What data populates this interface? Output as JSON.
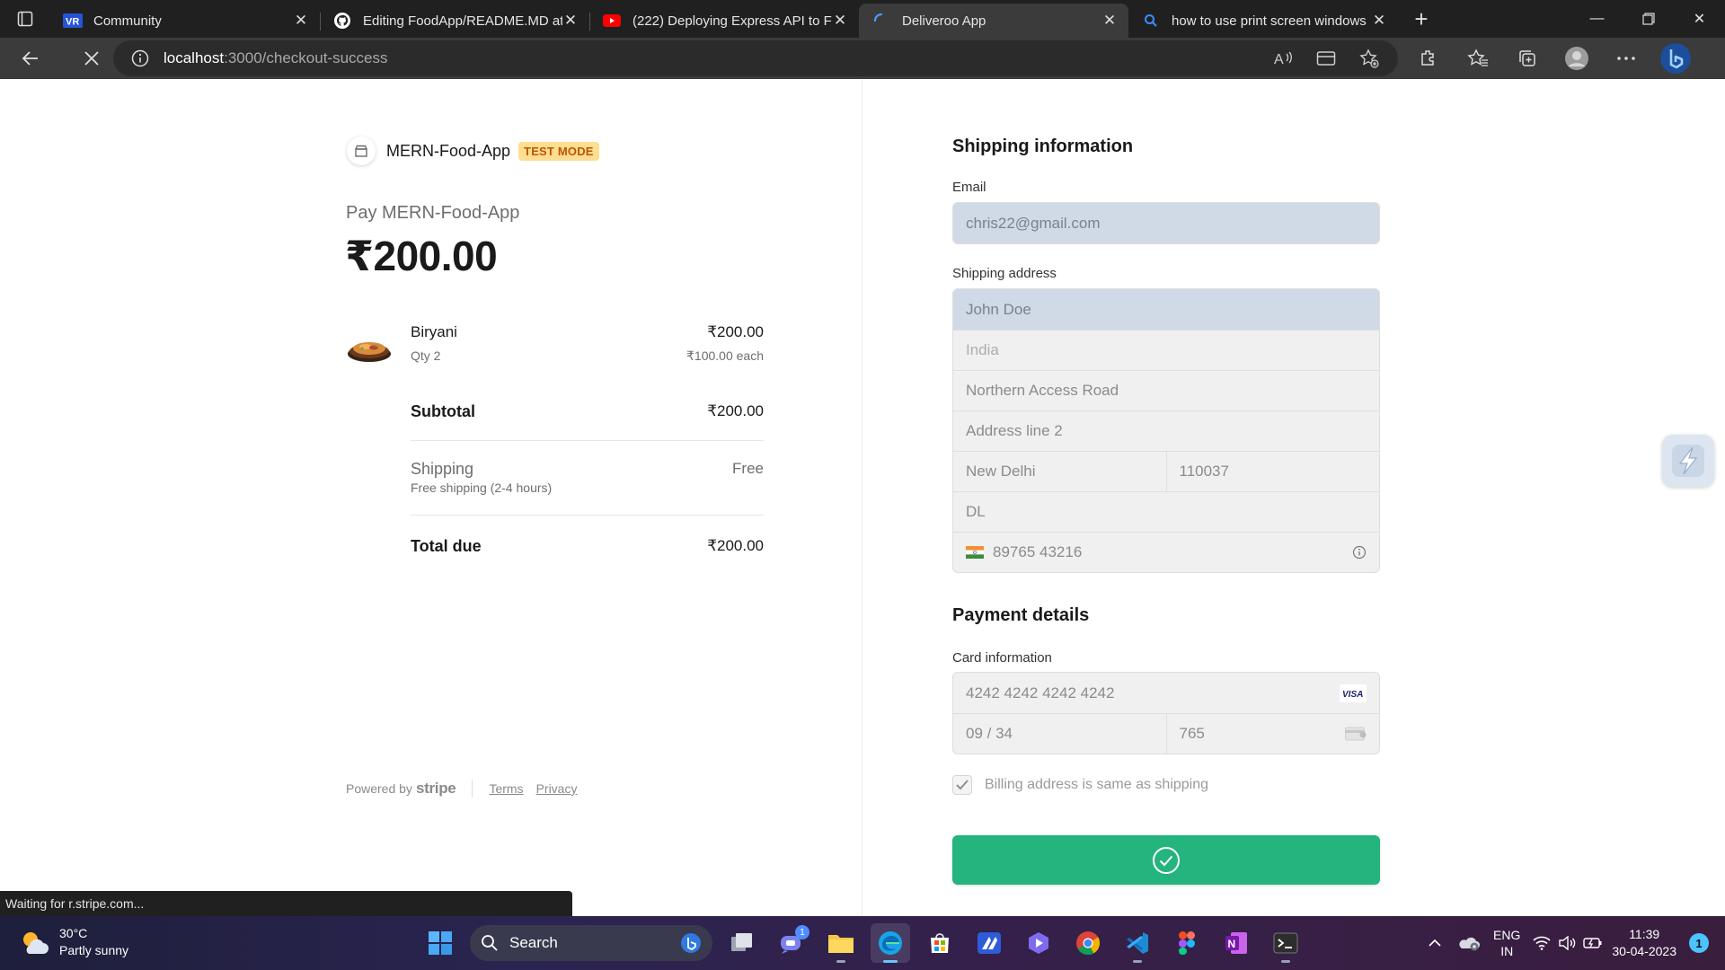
{
  "browser": {
    "tabs": [
      {
        "title": "Community",
        "icon": "vr-logo-icon",
        "active": false
      },
      {
        "title": "Editing FoodApp/README.MD at",
        "icon": "github-icon",
        "active": false
      },
      {
        "title": "(222) Deploying Express API to Fi",
        "icon": "youtube-icon",
        "active": false
      },
      {
        "title": "Deliveroo App",
        "icon": "loading-spinner-icon",
        "active": true
      },
      {
        "title": "how to use print screen windows",
        "icon": "bing-search-icon",
        "active": false
      }
    ],
    "url": {
      "host": "localhost",
      "path": ":3000/checkout-success"
    },
    "status_text": "Waiting for r.stripe.com..."
  },
  "checkout": {
    "merchant_name": "MERN-Food-App",
    "test_mode_label": "TEST MODE",
    "pay_label": "Pay MERN-Food-App",
    "amount": "₹200.00",
    "item": {
      "name": "Biryani",
      "qty": "Qty 2",
      "price": "₹200.00",
      "each": "₹100.00 each"
    },
    "subtotal": {
      "label": "Subtotal",
      "value": "₹200.00"
    },
    "shipping": {
      "label": "Shipping",
      "detail": "Free shipping (2-4 hours)",
      "value": "Free"
    },
    "total": {
      "label": "Total due",
      "value": "₹200.00"
    },
    "footer": {
      "powered": "Powered by",
      "brand": "stripe",
      "terms": "Terms",
      "privacy": "Privacy"
    }
  },
  "shipping_form": {
    "title": "Shipping information",
    "email_label": "Email",
    "email": "chris22@gmail.com",
    "address_label": "Shipping address",
    "name": "John Doe",
    "country": "India",
    "line1": "Northern Access Road",
    "line2": "Address line 2",
    "city": "New Delhi",
    "pin": "110037",
    "state": "DL",
    "phone": "89765 43216"
  },
  "payment_form": {
    "title": "Payment details",
    "card_label": "Card information",
    "card_number": "4242 4242 4242 4242",
    "card_brand": "VISA",
    "expiry": "09 / 34",
    "cvc": "765",
    "billing_same": "Billing address is same as shipping"
  },
  "taskbar": {
    "weather_temp": "30°C",
    "weather_desc": "Partly sunny",
    "search_label": "Search",
    "chat_badge": "1",
    "lang_top": "ENG",
    "lang_bottom": "IN",
    "time": "11:39",
    "date": "30-04-2023",
    "notifications": "1"
  },
  "colors": {
    "pay_button": "#24b47e",
    "test_mode_bg": "#ffde92",
    "test_mode_fg": "#bb5504"
  }
}
